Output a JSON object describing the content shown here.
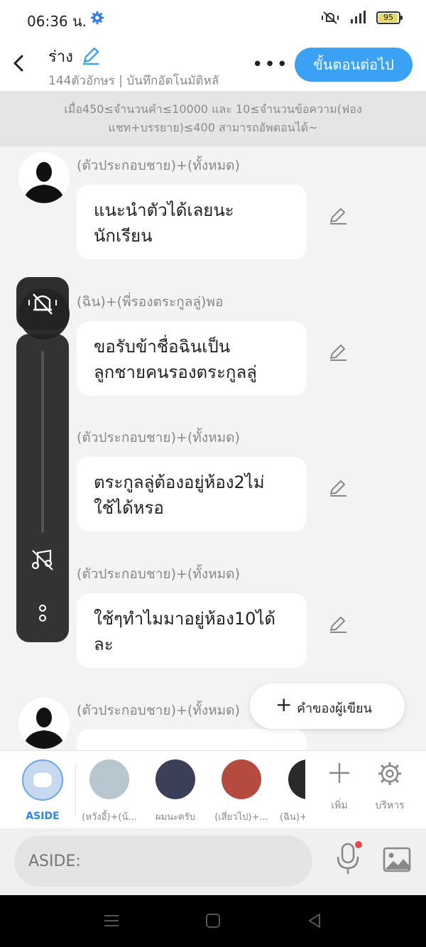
{
  "status": {
    "time": "06:36 น.",
    "battery": "95",
    "battery_level": 0.95
  },
  "header": {
    "title": "ร่าง",
    "subtitle": "144ตัวอักษร | บันทึกอัตโนมัติหลั",
    "more": "•••",
    "next_button": "ขั้นตอนต่อไป"
  },
  "notice": {
    "line1": "เมื่อ450≤จำนวนคำ≤10000 และ 10≤จำนวนข้อความ(ฟอง",
    "line2": "แชท+บรรยาย)≤400 สามารถอัพตอนได้~"
  },
  "messages": [
    {
      "speaker": "(ตัวประกอบชาย)+(ทั้งหมด)",
      "line1": "แนะนำตัวได้เลยนะ",
      "line2": "นักเรียน"
    },
    {
      "speaker": "(ฉิน)+(พี่รองตระกูลลู่)พอ",
      "line1": "ขอรับข้าชื่อฉินเป็น",
      "line2": "ลูกชายคนรองตระกูลลู่"
    },
    {
      "speaker": "(ตัวประกอบชาย)+(ทั้งหมด)",
      "line1": "ตระกูลลู่ต้องอยู่ห้อง2ไม่",
      "line2": "ใช้ได้หรอ"
    },
    {
      "speaker": "(ตัวประกอบชาย)+(ทั้งหมด)",
      "line1": "ใช้ๆทำไมมาอยู่ห้อง10ได้",
      "line2": "ละ"
    },
    {
      "speaker": "(ตัวประกอบชาย)+(ทั้งหมด)"
    }
  ],
  "author_button": {
    "plus": "+",
    "label": "คำของผู้เขียน"
  },
  "characters": {
    "aside": "ASIDE",
    "items": [
      {
        "name": "(หวังอี้)+(น้..."
      },
      {
        "name": "ผมนะครับ"
      },
      {
        "name": "(เสี่ยวไป)+..."
      },
      {
        "name": "(ฉิน)+("
      }
    ],
    "add": "เพิ่ม",
    "manage": "บริหาร"
  },
  "input": {
    "placeholder": "ASIDE:"
  },
  "colors": {
    "accent": "#3aa1f4",
    "aside": "#2c86e0",
    "notify": "#e84a4a"
  }
}
